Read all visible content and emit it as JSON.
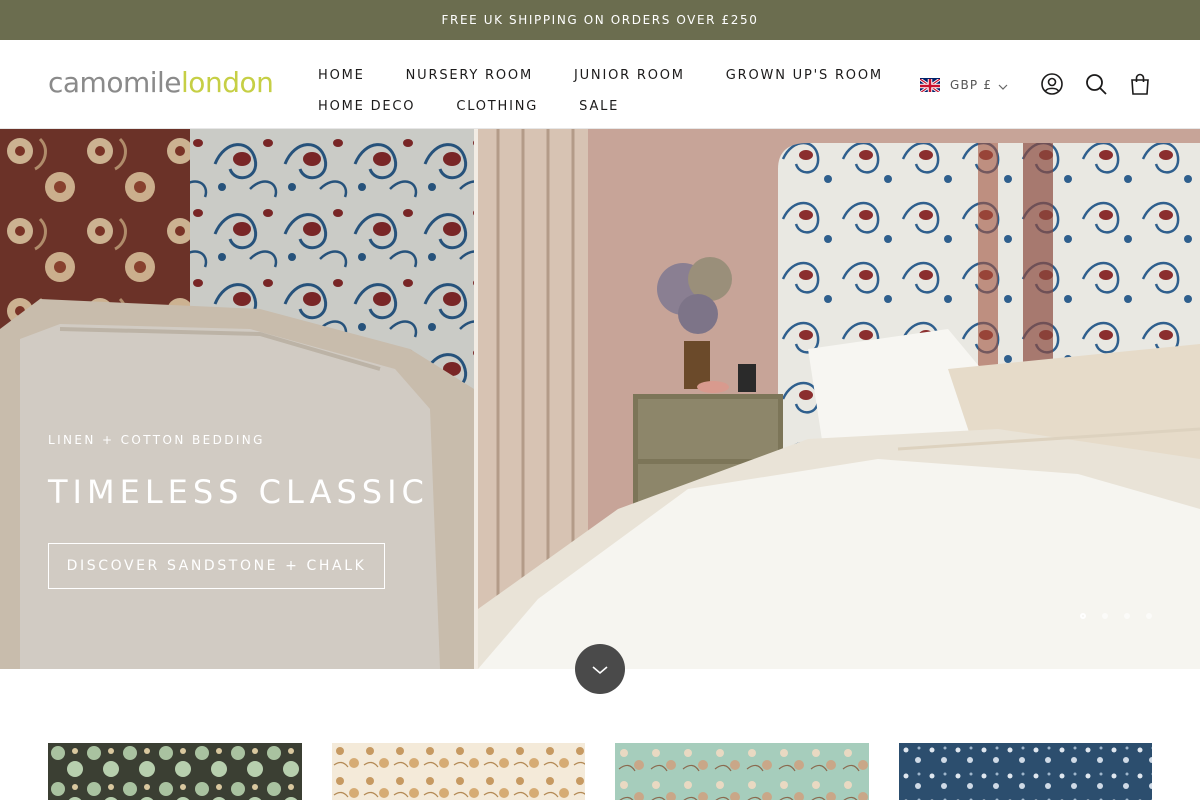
{
  "announcement": {
    "text": "FREE UK SHIPPING ON ORDERS OVER £250"
  },
  "brand": {
    "logo_part1": "camomile",
    "logo_part2": "london"
  },
  "nav": {
    "row1": [
      {
        "label": "HOME"
      },
      {
        "label": "NURSERY ROOM"
      },
      {
        "label": "JUNIOR ROOM"
      },
      {
        "label": "GROWN UP'S ROOM"
      }
    ],
    "row2": [
      {
        "label": "HOME DECO"
      },
      {
        "label": "CLOTHING"
      },
      {
        "label": "SALE"
      }
    ]
  },
  "header_actions": {
    "currency_label": "GBP £",
    "icons": [
      "account-icon",
      "search-icon",
      "cart-icon"
    ]
  },
  "hero": {
    "subheading": "LINEN + COTTON BEDDING",
    "title": "TIMELESS CLASSIC",
    "button_label": "DISCOVER SANDSTONE + CHALK",
    "slide_count": 4,
    "active_slide": 1
  },
  "collections": {
    "tiles": [
      {
        "pattern": "green-floral"
      },
      {
        "pattern": "tan-floral"
      },
      {
        "pattern": "mint-floral"
      },
      {
        "pattern": "navy-floral"
      }
    ]
  },
  "colors": {
    "announcement_bg": "#6b6d4f",
    "logo_grey": "#8a8a8a",
    "logo_lime": "#c6cf45",
    "scroll_button": "#4a4a4a"
  }
}
